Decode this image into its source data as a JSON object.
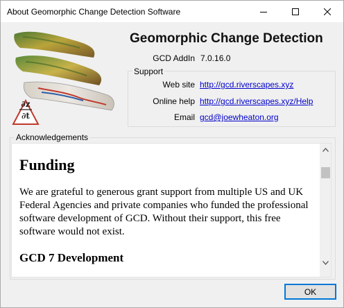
{
  "window": {
    "title": "About Geomorphic Change Detection Software"
  },
  "header": {
    "app_name": "Geomorphic Change Detection",
    "version_label": "GCD AddIn",
    "version_value": "7.0.16.0"
  },
  "support": {
    "title": "Support",
    "website_label": "Web site",
    "website_link": "http://gcd.riverscapes.xyz",
    "help_label": "Online help",
    "help_link": "http://gcd.riverscapes.xyz/Help",
    "email_label": "Email",
    "email_link": "gcd@joewheaton.org"
  },
  "acknowledgements": {
    "title": "Acknowledgements",
    "heading1": "Funding",
    "paragraph1": "We are grateful to generous grant support from multiple US and UK Federal Agencies and private companies who funded the professional software development of GCD. Without their support, this free software would not exist.",
    "heading2": "GCD 7 Development"
  },
  "logo": {
    "formula_top": "∂z",
    "formula_bottom": "∂t"
  },
  "buttons": {
    "ok_label": "OK"
  },
  "colors": {
    "link": "#0000cc",
    "focus_border": "#0078d7"
  },
  "icons": [
    "minimize-icon",
    "maximize-icon",
    "close-icon",
    "scroll-up-arrow-icon",
    "scroll-down-arrow-icon"
  ]
}
